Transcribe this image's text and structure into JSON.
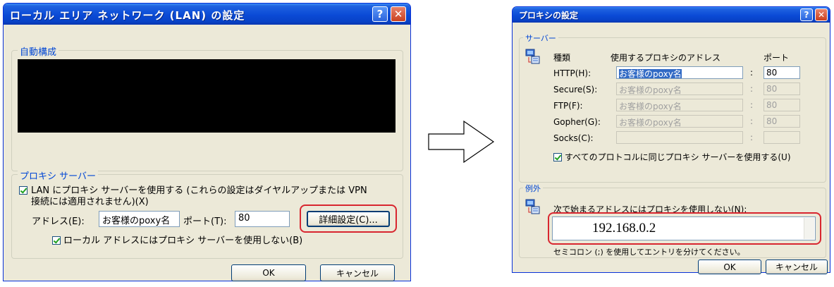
{
  "lan_dialog": {
    "title": "ローカル エリア ネットワーク (LAN) の設定",
    "help_glyph": "?",
    "close_glyph": "✕",
    "auto_config_legend": "自動構成",
    "proxy_legend": "プロキシ サーバー",
    "use_proxy_label": "LAN にプロキシ サーバーを使用する (これらの設定はダイヤルアップまたは VPN",
    "use_proxy_label_line2": "接続には適用されません)(X)",
    "address_label": "アドレス(E):",
    "address_value": "お客様のpoxy名",
    "port_label": "ポート(T):",
    "port_value": "80",
    "advanced_button": "詳細設定(C)...",
    "bypass_local_label": "ローカル アドレスにはプロキシ サーバーを使用しない(B)",
    "ok_button": "OK",
    "cancel_button": "キャンセル"
  },
  "proxy_dialog": {
    "title": "プロキシの設定",
    "help_glyph": "?",
    "close_glyph": "✕",
    "servers_legend": "サーバー",
    "col_type": "種類",
    "col_address": "使用するプロキシのアドレス",
    "col_port": "ポート",
    "rows": [
      {
        "label": "HTTP(H):",
        "address": "お客様のpoxy名",
        "port": "80"
      },
      {
        "label": "Secure(S):",
        "address": "お客様のpoxy名",
        "port": "80"
      },
      {
        "label": "FTP(F):",
        "address": "お客様のpoxy名",
        "port": "80"
      },
      {
        "label": "Gopher(G):",
        "address": "お客様のpoxy名",
        "port": "80"
      },
      {
        "label": "Socks(C):",
        "address": "",
        "port": ""
      }
    ],
    "colon": ":",
    "same_proxy_label": "すべてのプロトコルに同じプロキシ サーバーを使用する(U)",
    "exceptions_legend": "例外",
    "exceptions_label": "次で始まるアドレスにはプロキシを使用しない(N):",
    "exceptions_value": "192.168.0.2",
    "exceptions_hint": "セミコロン (;) を使用してエントリを分けてください。",
    "ok_button": "OK",
    "cancel_button": "キャンセル"
  },
  "arrow_icon": "right-arrow-icon",
  "colors": {
    "title_blue": "#0a4ad6",
    "dialog_face": "#ece9d8",
    "highlight_red": "#d8262f",
    "legend_blue": "#0046d5"
  }
}
